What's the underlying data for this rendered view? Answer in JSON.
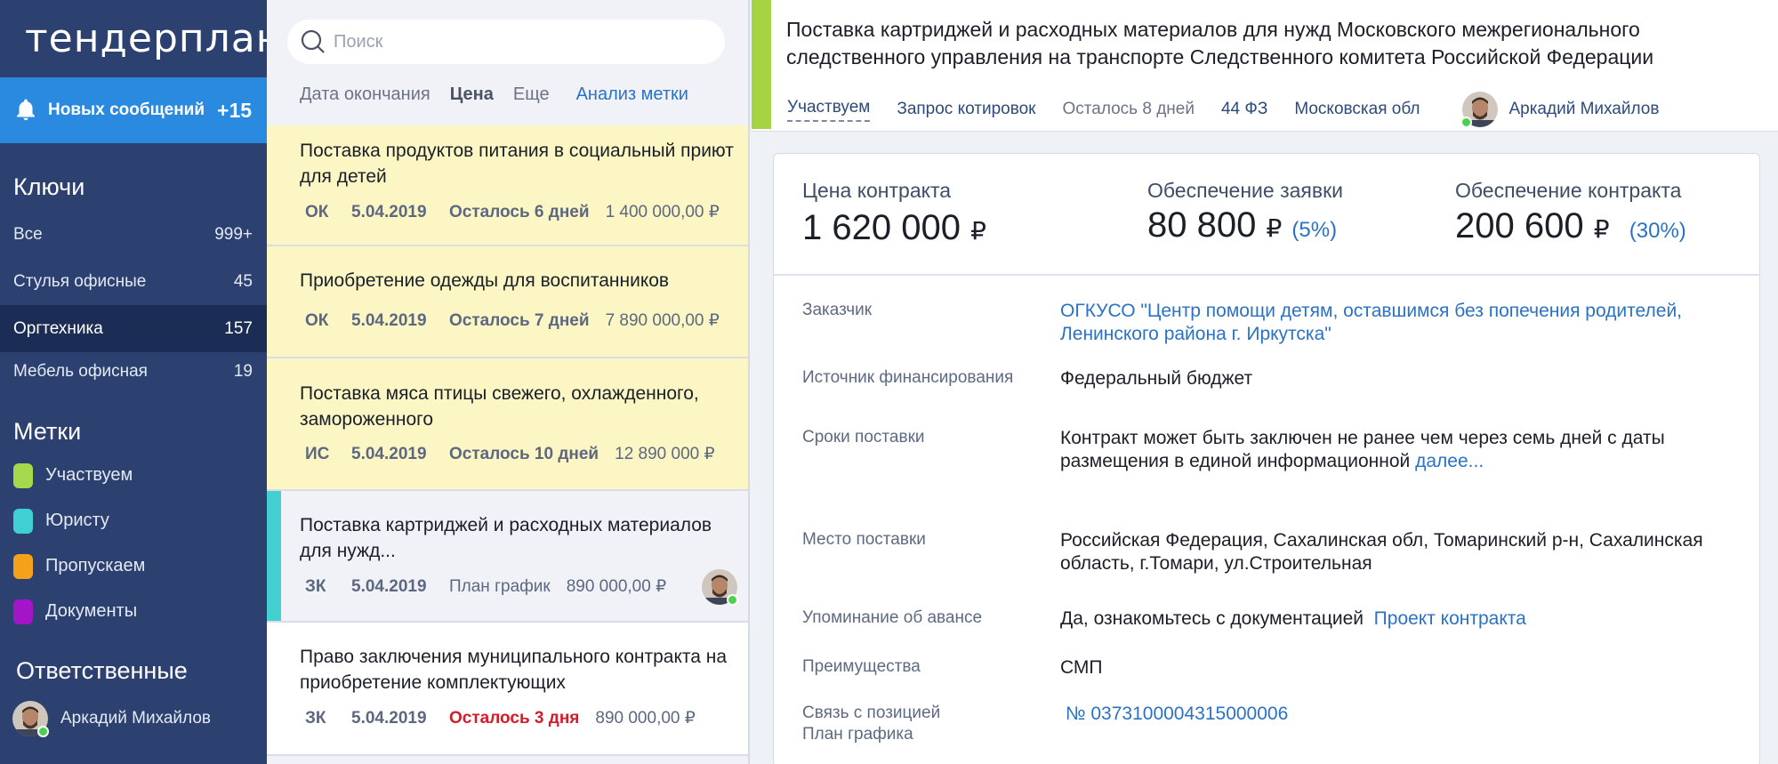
{
  "sidebar": {
    "logo": "тендерплан",
    "notifications": {
      "label": "Новых сообщений",
      "count": "+15"
    },
    "keys_title": "Ключи",
    "keys": [
      {
        "label": "Все",
        "count": "999+"
      },
      {
        "label": "Стулья офисные",
        "count": "45"
      },
      {
        "label": "Оргтехника",
        "count": "157",
        "active": true
      },
      {
        "label": "Мебель офисная",
        "count": "19"
      }
    ],
    "tags_title": "Метки",
    "tags": [
      {
        "label": "Участвуем",
        "color": "#a5d84a"
      },
      {
        "label": "Юристу",
        "color": "#3fd0d4"
      },
      {
        "label": "Пропускаем",
        "color": "#f4a21a"
      },
      {
        "label": "Документы",
        "color": "#a415c9"
      }
    ],
    "responsible_title": "Ответственные",
    "responsible": [
      {
        "name": "Аркадий Михайлов"
      }
    ]
  },
  "list": {
    "search_placeholder": "Поиск",
    "filters": {
      "end_date": "Дата окончания",
      "price": "Цена",
      "more": "Еще",
      "analysis": "Анализ метки"
    },
    "items": [
      {
        "title": "Поставка продуктов питания в социальный приют для детей",
        "type": "ОК",
        "date": "5.04.2019",
        "left": "Осталось 6 дней",
        "price": "1 400 000,00",
        "currency": "₽"
      },
      {
        "title": "Приобретение одежды для воспитанников",
        "type": "ОК",
        "date": "5.04.2019",
        "left": "Осталось 7 дней",
        "price": "7 890 000,00",
        "currency": "₽"
      },
      {
        "title": "Поставка мяса птицы свежего, охлажденного, замороженного",
        "type": "ИС",
        "date": "5.04.2019",
        "left": "Осталось 10 дней",
        "price": "12 890 000",
        "currency": "₽"
      },
      {
        "title": "Поставка картриджей и расходных материалов для нужд...",
        "type": "ЗК",
        "date": "5.04.2019",
        "left": "План график",
        "price": "890 000,00",
        "currency": "₽"
      },
      {
        "title": "Право заключения муниципального контракта на приобретение комплектующих",
        "type": "ЗК",
        "date": "5.04.2019",
        "left": "Осталось 3 дня",
        "price": "890 000,00",
        "currency": "₽"
      }
    ]
  },
  "detail": {
    "title": "Поставка картриджей и расходных материалов для нужд Московского межрегионального следственного управления на транспорте Следственного комитета Российской Федерации",
    "meta": {
      "status": "Участвуем",
      "procedure": "Запрос котировок",
      "remaining": "Осталось 8 дней",
      "law": "44 ФЗ",
      "region": "Московская обл",
      "user": "Аркадий Михайлов"
    },
    "prices": {
      "contract": {
        "label": "Цена контракта",
        "value": "1 620 000",
        "currency": "₽"
      },
      "bid": {
        "label": "Обеспечение заявки",
        "value": "80 800",
        "currency": "₽",
        "percent": "(5%)"
      },
      "guarantee": {
        "label": "Обеспечение контракта",
        "value": "200 600",
        "currency": "₽",
        "percent": "(30%)"
      }
    },
    "fields": {
      "customer": {
        "label": "Заказчик",
        "value": "ОГКУСО \"Центр помощи детям, оставшимся без попечения родителей, Ленинского района г. Иркутска\""
      },
      "funding": {
        "label": "Источник финансирования",
        "value": "Федеральный бюджет"
      },
      "terms": {
        "label": "Сроки поставки",
        "value": "Контракт может быть заключен не ранее чем через семь дней с даты размещения в единой информационной",
        "more": "далее..."
      },
      "place": {
        "label": "Место поставки",
        "value": "Российская Федерация, Сахалинская обл, Томаринский р-н, Сахалинская область, г.Томари, ул.Строительная"
      },
      "advance": {
        "label": "Упоминание об авансе",
        "value": "Да, ознакомьтесь с документацией",
        "link": "Проект контракта"
      },
      "advantages": {
        "label": "Преимущества",
        "value": "СМП"
      },
      "plan": {
        "label_line1": "Связь с позицией",
        "label_line2": "План графика",
        "value": "№ 0373100004315000006"
      }
    }
  }
}
